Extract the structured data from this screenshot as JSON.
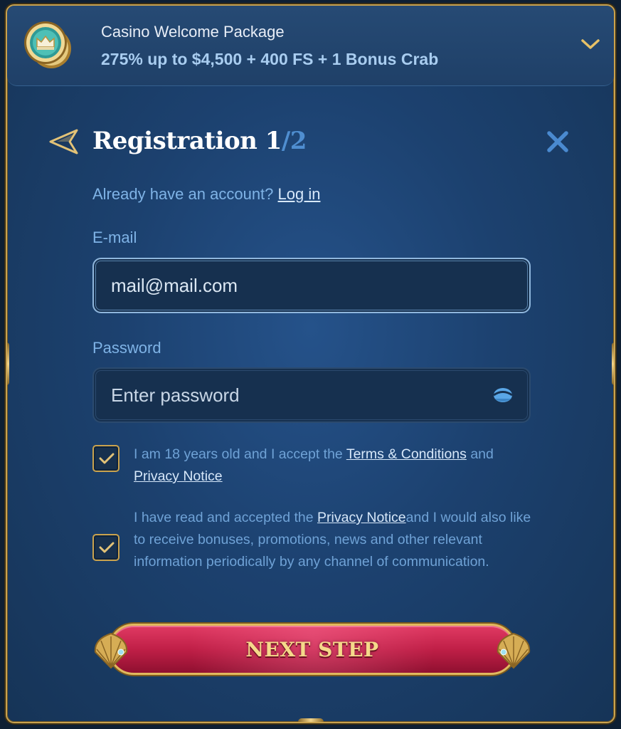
{
  "bonus": {
    "title": "Casino Welcome Package",
    "amount": "275% up to $4,500 + 400 FS + 1 Bonus Crab",
    "icon": "crown-coin-icon",
    "toggle_icon": "chevron-down-icon"
  },
  "header": {
    "title": "Registration 1",
    "step_total": "/2",
    "back_icon": "back-arrow-icon",
    "close_icon": "close-icon"
  },
  "account": {
    "prompt": "Already have an account?",
    "login_label": "Log in"
  },
  "form": {
    "email_label": "E-mail",
    "email_value": "mail@mail.com",
    "password_label": "Password",
    "password_placeholder": "Enter password",
    "password_toggle_icon": "eye-icon"
  },
  "consents": {
    "terms": {
      "checked": true,
      "text_before": "I am 18 years old and I accept the ",
      "terms_link": "Terms & Conditions",
      "text_middle": " and ",
      "privacy_link": "Privacy Notice"
    },
    "marketing": {
      "checked": true,
      "text_before": "I have read and accepted the ",
      "privacy_link": "Privacy Notice",
      "text_after": "and I would also like to receive bonuses, promotions, news and other relevant information periodically by any channel of communication."
    }
  },
  "actions": {
    "next_label": "NEXT STEP"
  },
  "colors": {
    "panel": "#1c416f",
    "gold": "#c9a24e",
    "accent_blue": "#4f8ed0",
    "button_red": "#c01f47"
  }
}
